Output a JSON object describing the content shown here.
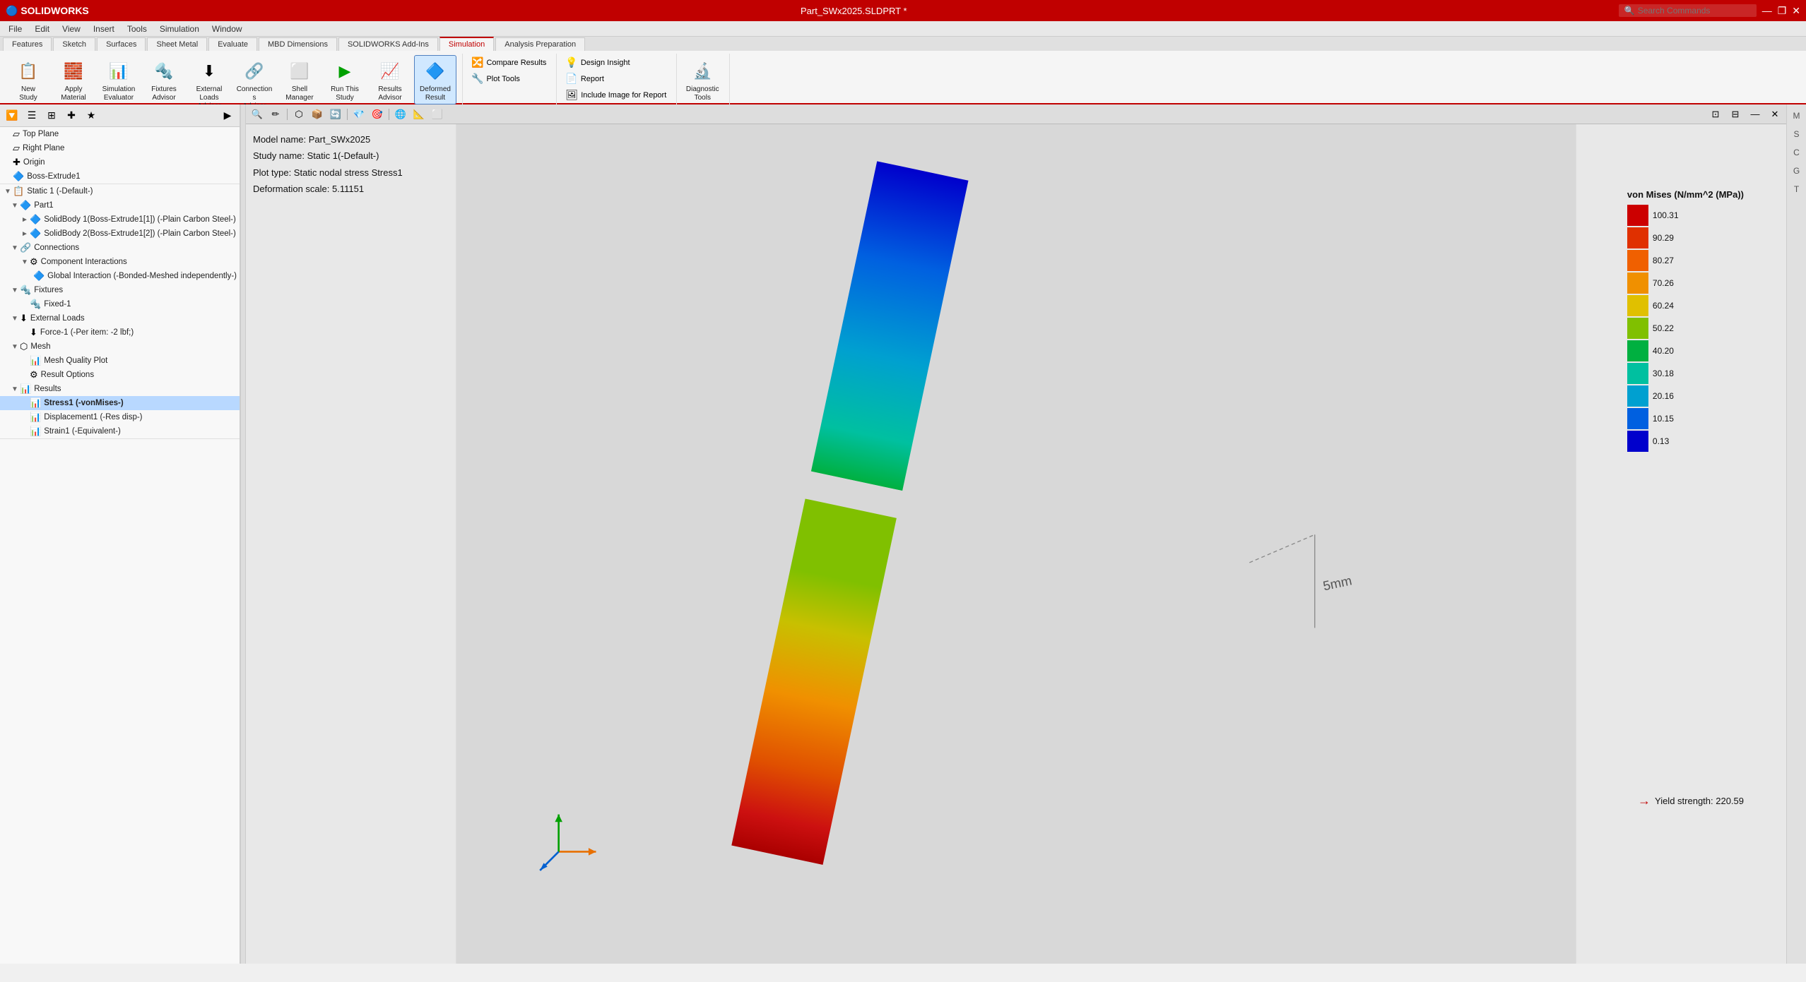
{
  "titlebar": {
    "title": "Part_SWx2025.SLDPRT *",
    "search_placeholder": "Search Commands",
    "controls": [
      "—",
      "❐",
      "✕"
    ]
  },
  "menubar": {
    "items": [
      "File",
      "Edit",
      "View",
      "Insert",
      "Tools",
      "Simulation",
      "Window"
    ]
  },
  "ribbon": {
    "tabs": [
      "Features",
      "Sketch",
      "Surfaces",
      "Sheet Metal",
      "Evaluate",
      "MBD Dimensions",
      "SOLIDWORKS Add-Ins",
      "Simulation",
      "Analysis Preparation"
    ],
    "active_tab": "Simulation",
    "groups": [
      {
        "label": "Study",
        "buttons": [
          {
            "id": "new-study",
            "label": "New\nStudy",
            "icon": "📋"
          },
          {
            "id": "apply-material",
            "label": "Apply\nMaterial",
            "icon": "🧱"
          },
          {
            "id": "simulation-evaluator",
            "label": "Simulation\nEvaluator",
            "icon": "📊"
          },
          {
            "id": "fixtures-advisor",
            "label": "Fixtures\nAdvisor",
            "icon": "🔩"
          },
          {
            "id": "external-loads-advisor",
            "label": "External Loads\nAdvisor",
            "icon": "⬇"
          },
          {
            "id": "connections-advisor",
            "label": "Connections\nAdvisor",
            "icon": "🔗"
          },
          {
            "id": "shell-manager",
            "label": "Shell\nManager",
            "icon": "⬜"
          },
          {
            "id": "run-this-study",
            "label": "Run This\nStudy",
            "icon": "▶"
          },
          {
            "id": "results-advisor",
            "label": "Results\nAdvisor",
            "icon": "📈"
          },
          {
            "id": "deformed-result",
            "label": "Deformed\nResult",
            "icon": "🔷",
            "active": true
          }
        ]
      },
      {
        "label": "",
        "small_buttons": [
          {
            "id": "compare-results",
            "label": "Compare\nResults",
            "icon": "🔀"
          },
          {
            "id": "plot-tools",
            "label": "Plot Tools",
            "icon": "🔧"
          }
        ],
        "buttons2": [
          {
            "id": "design-insight",
            "label": "Design Insight",
            "icon": "💡"
          },
          {
            "id": "report",
            "label": "Report",
            "icon": "📄"
          },
          {
            "id": "include-image",
            "label": "Include Image for Report",
            "icon": "🖼"
          }
        ]
      },
      {
        "label": "",
        "buttons": [
          {
            "id": "diagnostic-tools",
            "label": "Diagnostic\nTools",
            "icon": "🔬"
          }
        ]
      }
    ]
  },
  "leftpanel": {
    "panel_tools": [
      "filter",
      "list",
      "grid",
      "add",
      "star"
    ],
    "tree": {
      "top_section": [
        {
          "label": "Top Plane",
          "indent": 0,
          "icon": "▱",
          "expand": ""
        },
        {
          "label": "Right Plane",
          "indent": 0,
          "icon": "▱",
          "expand": ""
        },
        {
          "label": "Origin",
          "indent": 0,
          "icon": "✚",
          "expand": ""
        },
        {
          "label": "Boss-Extrude1",
          "indent": 0,
          "icon": "🔷",
          "expand": ""
        }
      ],
      "bottom_section": [
        {
          "label": "Static 1 (-Default-)",
          "indent": 0,
          "icon": "📋",
          "expand": "▼"
        },
        {
          "label": "Part1",
          "indent": 1,
          "icon": "🔷",
          "expand": "▼"
        },
        {
          "label": "SolidBody 1(Boss-Extrude1[1]) (-Plain Carbon Steel-)",
          "indent": 2,
          "icon": "🔷",
          "expand": "►"
        },
        {
          "label": "SolidBody 2(Boss-Extrude1[2]) (-Plain Carbon Steel-)",
          "indent": 2,
          "icon": "🔷",
          "expand": "►"
        },
        {
          "label": "Connections",
          "indent": 1,
          "icon": "🔗",
          "expand": "▼"
        },
        {
          "label": "Component Interactions",
          "indent": 2,
          "icon": "⚙",
          "expand": "▼"
        },
        {
          "label": "Global Interaction (-Bonded-Meshed independently-)",
          "indent": 3,
          "icon": "🔷",
          "expand": ""
        },
        {
          "label": "Fixtures",
          "indent": 1,
          "icon": "🔩",
          "expand": "▼"
        },
        {
          "label": "Fixed-1",
          "indent": 2,
          "icon": "🔩",
          "expand": ""
        },
        {
          "label": "External Loads",
          "indent": 1,
          "icon": "⬇",
          "expand": "▼"
        },
        {
          "label": "Force-1 (-Per item: -2 lbf;)",
          "indent": 2,
          "icon": "⬇",
          "expand": ""
        },
        {
          "label": "Mesh",
          "indent": 1,
          "icon": "⬡",
          "expand": "▼"
        },
        {
          "label": "Mesh Quality Plot",
          "indent": 2,
          "icon": "📊",
          "expand": ""
        },
        {
          "label": "Result Options",
          "indent": 2,
          "icon": "⚙",
          "expand": ""
        },
        {
          "label": "Results",
          "indent": 1,
          "icon": "📊",
          "expand": "▼"
        },
        {
          "label": "Stress1 (-vonMises-)",
          "indent": 2,
          "icon": "📊",
          "expand": "",
          "selected": true
        },
        {
          "label": "Displacement1 (-Res disp-)",
          "indent": 2,
          "icon": "📊",
          "expand": ""
        },
        {
          "label": "Strain1 (-Equivalent-)",
          "indent": 2,
          "icon": "📊",
          "expand": ""
        }
      ]
    }
  },
  "viewport": {
    "toolbar_tools": [
      "🔍",
      "✏",
      "⬡",
      "📦",
      "🔄",
      "💎",
      "🎯",
      "🌐",
      "📐",
      "⬜"
    ],
    "model_info": {
      "model_name": "Model name: Part_SWx2025",
      "study_name": "Study name: Static 1(-Default-)",
      "plot_type": "Plot type: Static nodal stress Stress1",
      "deformation": "Deformation scale: 5.11151"
    },
    "corner_controls": [
      "⊡",
      "⊟",
      "—",
      "✕"
    ]
  },
  "legend": {
    "title": "von Mises (N/mm^2 (MPa))",
    "entries": [
      {
        "value": "100.31",
        "color": "#cc0000"
      },
      {
        "value": "90.29",
        "color": "#e03000"
      },
      {
        "value": "80.27",
        "color": "#f06000"
      },
      {
        "value": "70.26",
        "color": "#f09000"
      },
      {
        "value": "60.24",
        "color": "#e0c000"
      },
      {
        "value": "50.22",
        "color": "#80c000"
      },
      {
        "value": "40.20",
        "color": "#00b040"
      },
      {
        "value": "30.18",
        "color": "#00c0a0"
      },
      {
        "value": "20.16",
        "color": "#00a0d0"
      },
      {
        "value": "10.15",
        "color": "#0060e0"
      },
      {
        "value": "0.13",
        "color": "#0000cc"
      }
    ],
    "yield_label": "Yield strength: 220.59"
  },
  "right_toolbar": {
    "buttons": [
      "M",
      "S",
      "C",
      "G",
      "T"
    ]
  }
}
